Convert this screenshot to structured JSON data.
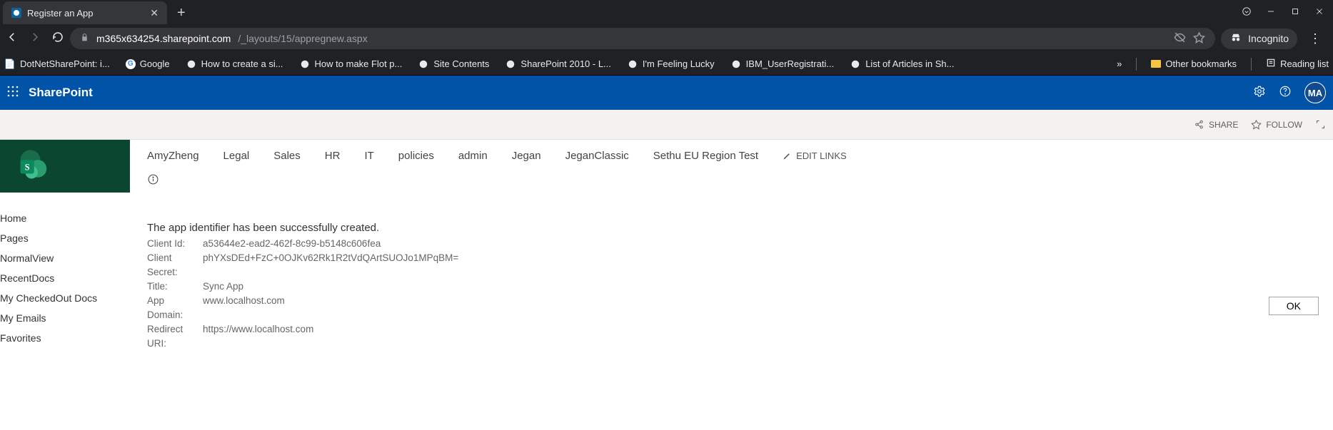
{
  "browser": {
    "tab_title": "Register an App",
    "url_host": "m365x634254.sharepoint.com",
    "url_path": "/_layouts/15/appregnew.aspx",
    "incognito_label": "Incognito",
    "bookmarks": [
      "DotNetSharePoint: i...",
      "Google",
      "How to create a si...",
      "How to make Flot p...",
      "Site Contents",
      "SharePoint 2010 - L...",
      "I'm Feeling Lucky",
      "IBM_UserRegistrati...",
      "List of Articles in Sh..."
    ],
    "bookmarks_overflow": "»",
    "other_bookmarks": "Other bookmarks",
    "reading_list": "Reading list"
  },
  "suite": {
    "brand": "SharePoint",
    "avatar_initials": "MA"
  },
  "ribbon": {
    "share": "SHARE",
    "follow": "FOLLOW"
  },
  "topnav": {
    "items": [
      "AmyZheng",
      "Legal",
      "Sales",
      "HR",
      "IT",
      "policies",
      "admin",
      "Jegan",
      "JeganClassic",
      "Sethu EU Region Test"
    ],
    "edit_links": "EDIT LINKS"
  },
  "quicklaunch": {
    "items": [
      "Home",
      "Pages",
      "NormalView",
      "RecentDocs",
      "My CheckedOut Docs",
      "My Emails",
      "Favorites"
    ]
  },
  "message": "The app identifier has been successfully created.",
  "details": {
    "client_id_label": "Client Id:",
    "client_id": "a53644e2-ead2-462f-8c99-b5148c606fea",
    "client_secret_label": "Client Secret:",
    "client_secret": "phYXsDEd+FzC+0OJKv62Rk1R2tVdQArtSUOJo1MPqBM=",
    "title_label": "Title:",
    "title": "Sync App",
    "app_domain_label": "App Domain:",
    "app_domain": "www.localhost.com",
    "redirect_label": "Redirect URI:",
    "redirect": "https://www.localhost.com"
  },
  "buttons": {
    "ok": "OK"
  }
}
